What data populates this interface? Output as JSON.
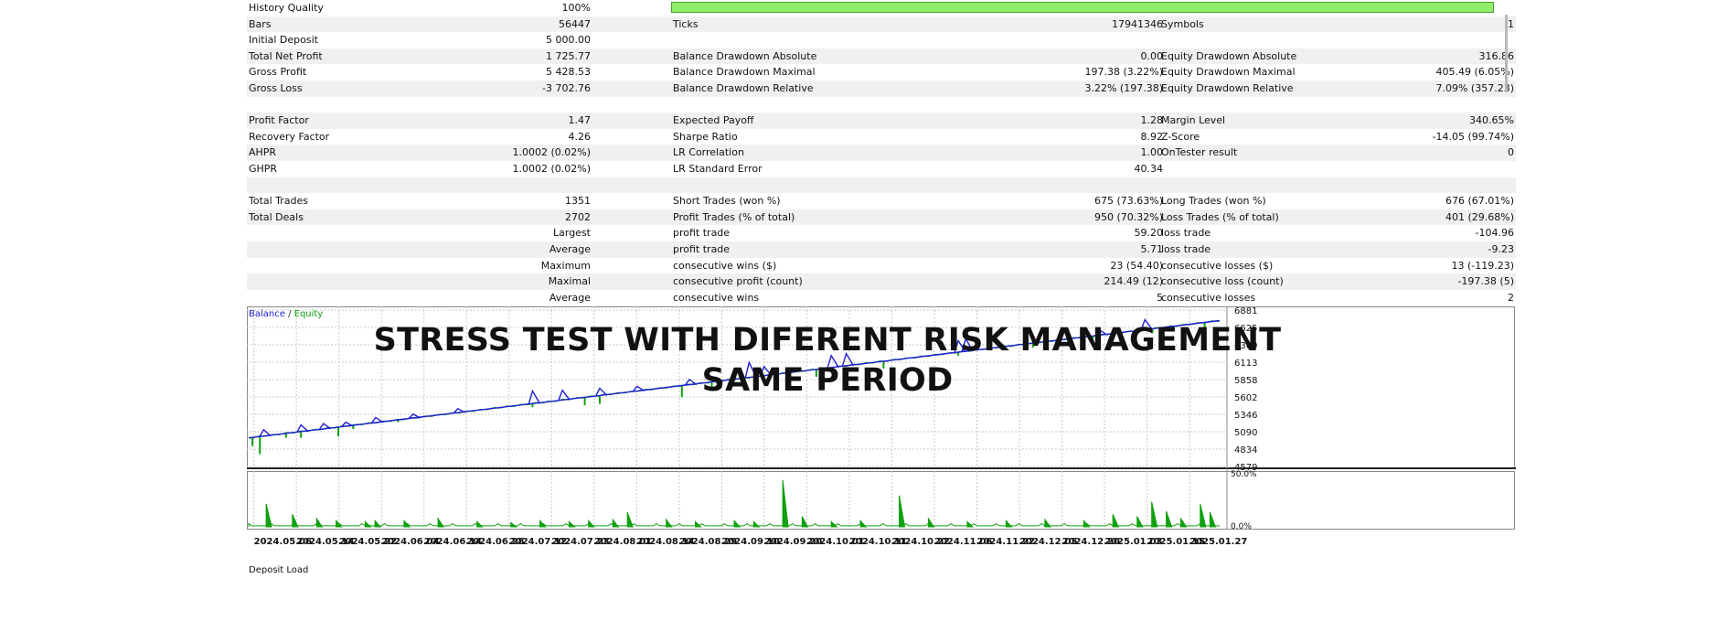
{
  "report": {
    "quality": {
      "label": "History Quality",
      "value": "100%"
    },
    "rows": [
      {
        "cells": [
          "Bars",
          "56447",
          "Ticks",
          "17941346",
          "Symbols",
          "1"
        ]
      },
      {
        "cells": [
          "Initial Deposit",
          "5 000.00",
          "",
          "",
          "",
          ""
        ]
      },
      {
        "cells": [
          "Total Net Profit",
          "1 725.77",
          "Balance Drawdown Absolute",
          "0.00",
          "Equity Drawdown Absolute",
          "316.86"
        ]
      },
      {
        "cells": [
          "Gross Profit",
          "5 428.53",
          "Balance Drawdown Maximal",
          "197.38 (3.22%)",
          "Equity Drawdown Maximal",
          "405.49 (6.05%)"
        ]
      },
      {
        "cells": [
          "Gross Loss",
          "-3 702.76",
          "Balance Drawdown Relative",
          "3.22% (197.38)",
          "Equity Drawdown Relative",
          "7.09% (357.23)"
        ]
      },
      {
        "cells": [
          "",
          "",
          "",
          "",
          "",
          ""
        ]
      },
      {
        "cells": [
          "Profit Factor",
          "1.47",
          "Expected Payoff",
          "1.28",
          "Margin Level",
          "340.65%"
        ]
      },
      {
        "cells": [
          "Recovery Factor",
          "4.26",
          "Sharpe Ratio",
          "8.92",
          "Z-Score",
          "-14.05 (99.74%)"
        ]
      },
      {
        "cells": [
          "AHPR",
          "1.0002 (0.02%)",
          "LR Correlation",
          "1.00",
          "OnTester result",
          "0"
        ]
      },
      {
        "cells": [
          "GHPR",
          "1.0002 (0.02%)",
          "LR Standard Error",
          "40.34",
          "",
          ""
        ]
      },
      {
        "cells": [
          "",
          "",
          "",
          "",
          "",
          ""
        ]
      },
      {
        "cells": [
          "Total Trades",
          "1351",
          "Short Trades (won %)",
          "675 (73.63%)",
          "Long Trades (won %)",
          "676 (67.01%)"
        ]
      },
      {
        "cells": [
          "Total Deals",
          "2702",
          "Profit Trades (% of total)",
          "950 (70.32%)",
          "Loss Trades (% of total)",
          "401 (29.68%)"
        ]
      },
      {
        "cells": [
          "",
          "Largest",
          "profit trade",
          "59.20",
          "loss trade",
          "-104.96"
        ]
      },
      {
        "cells": [
          "",
          "Average",
          "profit trade",
          "5.71",
          "loss trade",
          "-9.23"
        ]
      },
      {
        "cells": [
          "",
          "Maximum",
          "consecutive wins ($)",
          "23 (54.40)",
          "consecutive losses ($)",
          "13 (-119.23)"
        ]
      },
      {
        "cells": [
          "",
          "Maximal",
          "consecutive profit (count)",
          "214.49 (12)",
          "consecutive loss (count)",
          "-197.38 (5)"
        ]
      },
      {
        "cells": [
          "",
          "Average",
          "consecutive wins",
          "5",
          "consecutive losses",
          "2"
        ]
      }
    ]
  },
  "overlay": {
    "line1": "STRESS TEST WITH DIFERENT RISK MANAGEMENT",
    "line2": "SAME PERIOD"
  },
  "chart_data": {
    "type": "line",
    "legend": {
      "balance": "Balance",
      "separator": "/",
      "equity": "Equity"
    },
    "colors": {
      "balance": "#1f1fd6",
      "equity": "#10a010",
      "deposit": "#10a010",
      "grid": "#c8c8c8"
    },
    "y_ticks": [
      6881,
      6625,
      6369,
      6113,
      5858,
      5602,
      5346,
      5090,
      4834,
      4579
    ],
    "ylim": [
      4579,
      6881
    ],
    "start_balance": 5000,
    "end_balance": 6726,
    "x_tick_labels": [
      "2024.05.06",
      "2024.05.14",
      "2024.05.22",
      "2024.06.04",
      "2024.06.14",
      "2024.06.28",
      "2024.07.12",
      "2024.07.23",
      "2024.08.01",
      "2024.08.14",
      "2024.08.29",
      "2024.09.10",
      "2024.09.20",
      "2024.10.01",
      "2024.10.11",
      "2024.10.22",
      "2024.11.06",
      "2024.11.22",
      "2024.12.05",
      "2024.12.20",
      "2025.01.03",
      "2025.01.15",
      "2025.01.27"
    ],
    "balance_spikes": [
      {
        "x": 0.02,
        "v": 5120
      },
      {
        "x": 0.07,
        "v": 5190
      },
      {
        "x": 0.1,
        "v": 5210
      },
      {
        "x": 0.13,
        "v": 5230
      },
      {
        "x": 0.17,
        "v": 5300
      },
      {
        "x": 0.22,
        "v": 5350
      },
      {
        "x": 0.28,
        "v": 5430
      },
      {
        "x": 0.38,
        "v": 5690
      },
      {
        "x": 0.42,
        "v": 5700
      },
      {
        "x": 0.47,
        "v": 5730
      },
      {
        "x": 0.52,
        "v": 5760
      },
      {
        "x": 0.59,
        "v": 5860
      },
      {
        "x": 0.67,
        "v": 6110
      },
      {
        "x": 0.69,
        "v": 6050
      },
      {
        "x": 0.78,
        "v": 6210
      },
      {
        "x": 0.8,
        "v": 6240
      },
      {
        "x": 0.95,
        "v": 6430
      },
      {
        "x": 0.96,
        "v": 6460
      },
      {
        "x": 1.14,
        "v": 6580
      },
      {
        "x": 1.2,
        "v": 6740
      },
      {
        "x": 0.0,
        "v": 0
      }
    ],
    "equity_drops": [
      {
        "x": 0.005,
        "v": 4880
      },
      {
        "x": 0.015,
        "v": 4760
      },
      {
        "x": 0.05,
        "v": 5000
      },
      {
        "x": 0.07,
        "v": 5000
      },
      {
        "x": 0.12,
        "v": 5020
      },
      {
        "x": 0.14,
        "v": 5130
      },
      {
        "x": 0.2,
        "v": 5230
      },
      {
        "x": 0.38,
        "v": 5450
      },
      {
        "x": 0.45,
        "v": 5480
      },
      {
        "x": 0.47,
        "v": 5500
      },
      {
        "x": 0.58,
        "v": 5600
      },
      {
        "x": 0.62,
        "v": 5690
      },
      {
        "x": 0.76,
        "v": 5900
      },
      {
        "x": 0.85,
        "v": 6020
      },
      {
        "x": 0.95,
        "v": 6210
      },
      {
        "x": 1.01,
        "v": 6300
      },
      {
        "x": 1.05,
        "v": 6330
      },
      {
        "x": 1.13,
        "v": 6410
      },
      {
        "x": 1.16,
        "v": 6500
      },
      {
        "x": 1.21,
        "v": 6540
      },
      {
        "x": 1.28,
        "v": 6320
      }
    ],
    "deposit_load": {
      "y_ticks": [
        "50.0%",
        "0.0%"
      ],
      "label": "Deposit Load",
      "ylim": [
        0,
        50
      ],
      "spikes": [
        {
          "t": 0.018,
          "v": 22
        },
        {
          "t": 0.045,
          "v": 12
        },
        {
          "t": 0.07,
          "v": 8
        },
        {
          "t": 0.09,
          "v": 6
        },
        {
          "t": 0.12,
          "v": 5
        },
        {
          "t": 0.13,
          "v": 6
        },
        {
          "t": 0.16,
          "v": 6
        },
        {
          "t": 0.195,
          "v": 8
        },
        {
          "t": 0.235,
          "v": 5
        },
        {
          "t": 0.27,
          "v": 4
        },
        {
          "t": 0.3,
          "v": 6
        },
        {
          "t": 0.33,
          "v": 5
        },
        {
          "t": 0.35,
          "v": 6
        },
        {
          "t": 0.375,
          "v": 7
        },
        {
          "t": 0.39,
          "v": 14
        },
        {
          "t": 0.43,
          "v": 7
        },
        {
          "t": 0.46,
          "v": 5
        },
        {
          "t": 0.5,
          "v": 6
        },
        {
          "t": 0.52,
          "v": 5
        },
        {
          "t": 0.55,
          "v": 45
        },
        {
          "t": 0.57,
          "v": 10
        },
        {
          "t": 0.6,
          "v": 5
        },
        {
          "t": 0.63,
          "v": 6
        },
        {
          "t": 0.67,
          "v": 30
        },
        {
          "t": 0.7,
          "v": 8
        },
        {
          "t": 0.74,
          "v": 5
        },
        {
          "t": 0.78,
          "v": 6
        },
        {
          "t": 0.82,
          "v": 7
        },
        {
          "t": 0.86,
          "v": 6
        },
        {
          "t": 0.89,
          "v": 12
        },
        {
          "t": 0.915,
          "v": 10
        },
        {
          "t": 0.93,
          "v": 24
        },
        {
          "t": 0.945,
          "v": 15
        },
        {
          "t": 0.96,
          "v": 8
        },
        {
          "t": 0.98,
          "v": 22
        },
        {
          "t": 0.99,
          "v": 14
        }
      ]
    }
  }
}
